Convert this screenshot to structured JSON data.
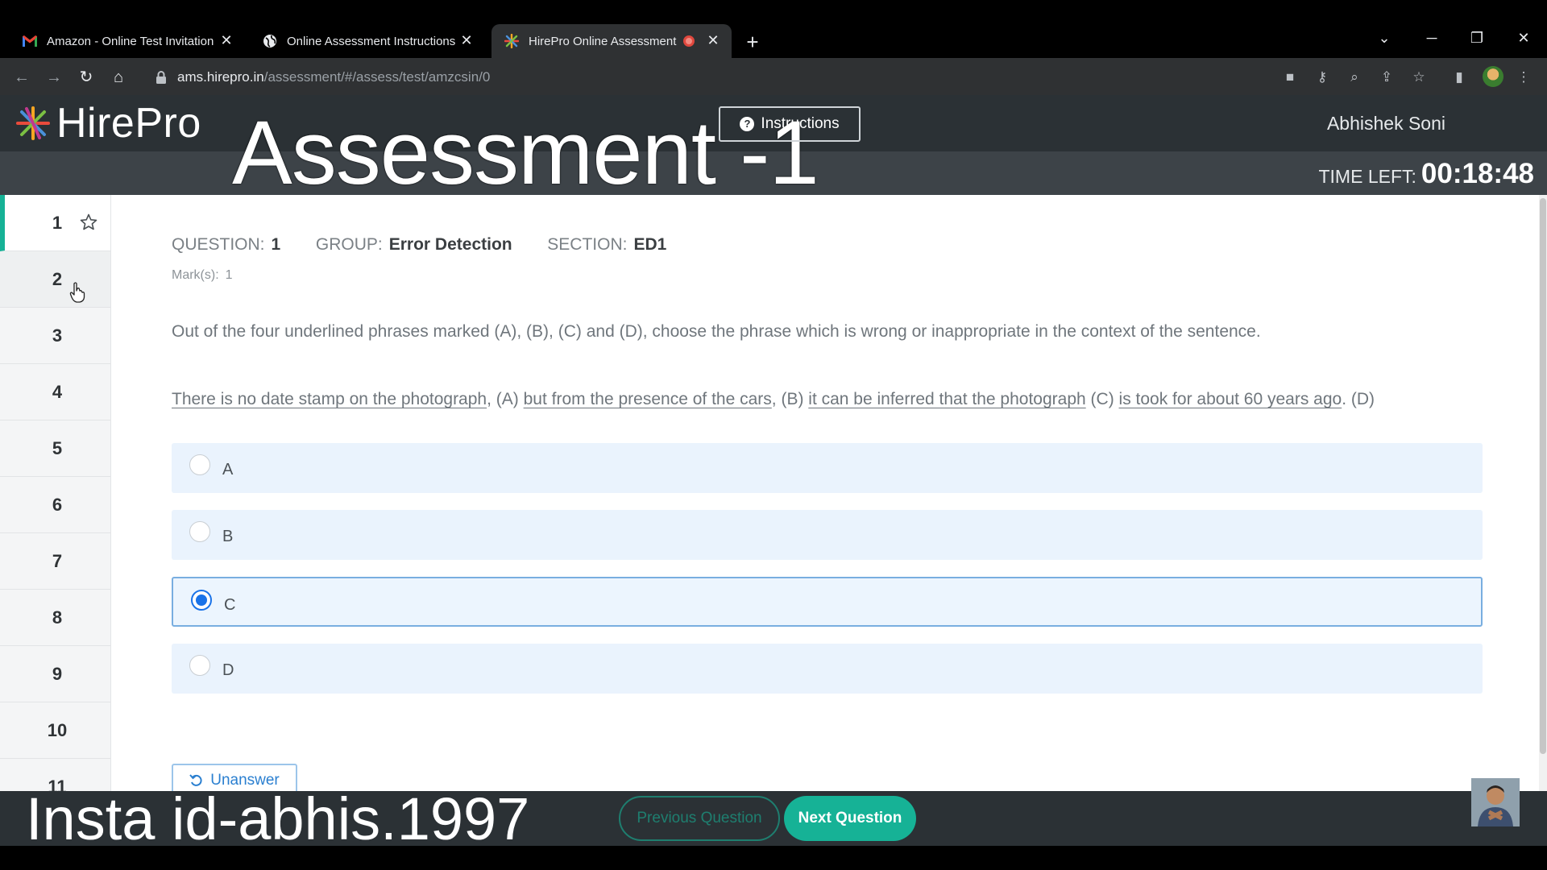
{
  "browser": {
    "tabs": [
      {
        "title": "Amazon - Online Test Invitation",
        "icon": "gmail-icon"
      },
      {
        "title": "Online Assessment Instructions",
        "icon": "globe-icon"
      },
      {
        "title": "HirePro Online Assessment",
        "icon": "hirepro-icon",
        "active": true,
        "recording": true
      }
    ],
    "url_host": "ams.hirepro.in",
    "url_path": "/assessment/#/assess/test/amzcsin/0"
  },
  "header": {
    "logo_text": "HirePro",
    "overlay_title": "Assessment -1",
    "instructions_label": "Instructions",
    "user_name": "Abhishek Soni",
    "time_left_label": "TIME LEFT:",
    "time_left_value": "00:18:48"
  },
  "question_nav": {
    "items": [
      "1",
      "2",
      "3",
      "4",
      "5",
      "6",
      "7",
      "8",
      "9",
      "10",
      "11"
    ],
    "active": "1"
  },
  "question": {
    "question_label": "QUESTION:",
    "question_number": "1",
    "group_label": "GROUP:",
    "group_value": "Error Detection",
    "section_label": "SECTION:",
    "section_value": "ED1",
    "marks_label": "Mark(s):",
    "marks_value": "1",
    "prompt": "Out of the four underlined phrases marked (A), (B), (C) and (D), choose the phrase which is wrong or inappropriate in the context of the sentence.",
    "sentence": [
      {
        "phrase": "There is no date stamp on the photograph",
        "after": ", (A) "
      },
      {
        "phrase": "but from the presence of the cars",
        "after": ", (B) "
      },
      {
        "phrase": "it can be inferred that the photograph",
        "after": " (C) "
      },
      {
        "phrase": "is took for about 60 years ago",
        "after": ". (D)"
      }
    ],
    "options": [
      {
        "label": "A",
        "selected": false
      },
      {
        "label": "B",
        "selected": false
      },
      {
        "label": "C",
        "selected": true
      },
      {
        "label": "D",
        "selected": false
      }
    ],
    "unanswer_label": "Unanswer"
  },
  "footer": {
    "watermark": "Insta id-abhis.1997",
    "prev_label": "Previous Question",
    "next_label": "Next Question"
  },
  "colors": {
    "accent": "#16b296",
    "header_bg": "#2b3135",
    "option_bg": "#eaf3fd",
    "link_blue": "#2a7fd0"
  }
}
